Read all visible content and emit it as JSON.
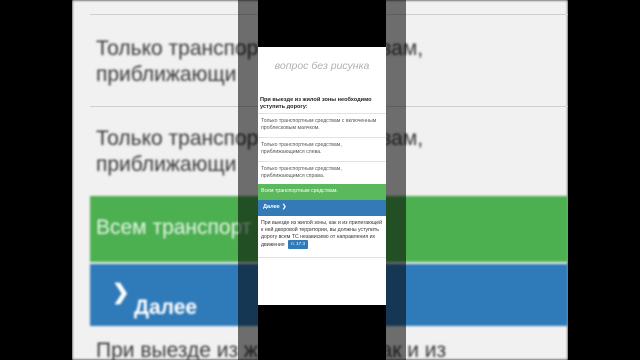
{
  "background": {
    "answer_a": [
      "Только транспортным средствам,",
      "приближающи"
    ],
    "answer_b": [
      "Только транспортным средствам,",
      "приближающи"
    ],
    "correct_answer": "Всем транспорт",
    "next_label": "Далее",
    "explanation_start": "При выезде из жилой зоны, как и из"
  },
  "quiz": {
    "title": "вопрос без рисунка",
    "question": "При выезде из жилой зоны необходимо уступить дорогу:",
    "answers": [
      "Только транспортным средствам с включенным проблесковым маячком.",
      "Только транспортным средствам, приближающимся слева.",
      "Только транспортным средствам, приближающимся справа."
    ],
    "correct_answer": "Всем транспортным средствам.",
    "next_label": "Далее",
    "explanation": "При выезде из жилой зоны, как и из прилегающей к ней дворовой территории, вы должны уступить дорогу всем ТС независимо от направления их движения",
    "rule_ref": "п. 17.3"
  },
  "colors": {
    "correct": "#5cb85c",
    "primary": "#337ab7"
  },
  "icons": {
    "next": "chevron-right-icon"
  }
}
